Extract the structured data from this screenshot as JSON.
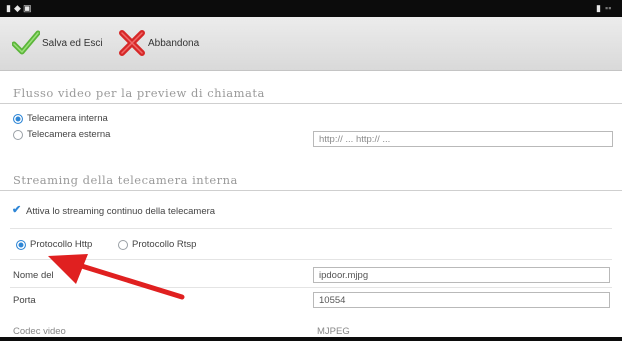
{
  "toolbar": {
    "save_label": "Salva ed Esci",
    "abandon_label": "Abbandona"
  },
  "video_section": {
    "title": "Flusso video per la preview di chiamata",
    "options": [
      {
        "label": "Telecamera interna",
        "selected": true
      },
      {
        "label": "Telecamera esterna",
        "selected": false
      }
    ],
    "url_placeholder": "http:// ... http:// ..."
  },
  "streaming_section": {
    "title": "Streaming della telecamera interna",
    "checkbox_label": "Attiva lo streaming continuo della telecamera",
    "checkbox_checked": true,
    "protocols": [
      {
        "label": "Protocollo Http",
        "selected": true
      },
      {
        "label": "Protocollo Rtsp",
        "selected": false
      }
    ],
    "filename_label": "Nome del",
    "filename_value": "ipdoor.mjpg",
    "port_label": "Porta",
    "port_value": "10554",
    "codec_label": "Codec video",
    "codec_value": "MJPEG"
  },
  "colors": {
    "accent": "#2e86d6",
    "annotation_arrow": "#e02020"
  }
}
